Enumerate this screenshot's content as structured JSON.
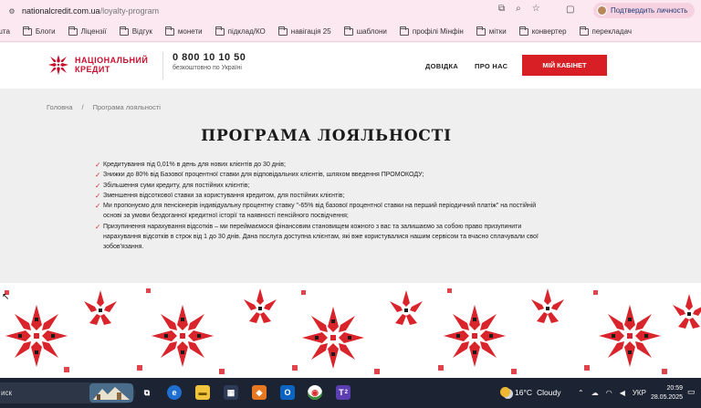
{
  "browser": {
    "url_domain": "nationalcredit.com.ua",
    "url_path": "/loyalty-program",
    "profile_label": "Подтвердить личность"
  },
  "bookmarks": [
    "ошта",
    "Блоги",
    "Ліцензії",
    "Відгук",
    "монети",
    "підклад/КО",
    "навігація 25",
    "шаблони",
    "профілі Мінфін",
    "мітки",
    "конвертер",
    "перекладач"
  ],
  "header": {
    "logo_line1": "НАЦІОНАЛЬНИЙ",
    "logo_line2": "КРЕДИТ",
    "phone": "0 800 10 10 50",
    "phone_note": "безкоштовно по Україні",
    "nav_help": "ДОВІДКА",
    "nav_about": "ПРО НАС",
    "cabinet_button": "МІЙ КАБІНЕТ"
  },
  "breadcrumb": {
    "home": "Головна",
    "separator": "/",
    "current": "Програма лояльності"
  },
  "page_title": "ПРОГРАМА ЛОЯЛЬНОСТІ",
  "bullets": [
    "Кредитування під 0,01% в день для нових клієнтів до 30 днів;",
    "Знижки до 80% від Базової процентної ставки для відповідальних клієнтів, шляхом введення ПРОМОКОДУ;",
    "Збільшення суми кредиту, для постійних клієнтів;",
    "Зменшення відсоткової ставки за користування кредитом, для постійних клієнтів;",
    "Ми пропонуємо для пенсіонерів індивідуальну процентну ставку \"-65% від базової процентної ставки на перший періодичний платіж\" на постійній основі за умови бездоганної кредитної історії та наявності пенсійного посвідчення;",
    "Призупинення нарахування відсотків – ми переймаємося фінансовим становищем кожного з вас та залишаємо за собою право призупинити нарахування відсотків в строк від 1 до 30 днів. Дана послуга доступна клієнтам, які вже користувалися нашим сервісом та вчасно сплачували свої зобов'язання."
  ],
  "taskbar": {
    "search_text": "иск",
    "weather_temp": "16°C",
    "weather_text": "Cloudy",
    "language": "УКР",
    "time": "20:59",
    "date": "28.05.2025",
    "mail_badge": "2"
  },
  "colors": {
    "brand_red": "#d91f26",
    "tab_bar_pink": "#fce8f0",
    "taskbar": "#1c2433"
  }
}
